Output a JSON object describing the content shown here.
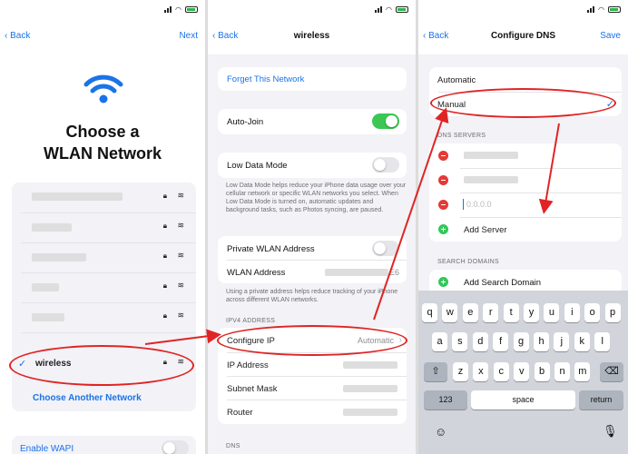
{
  "panel1": {
    "back_label": "Back",
    "next_label": "Next",
    "title_line1": "Choose a",
    "title_line2": "WLAN Network",
    "selected_network": "wireless",
    "choose_another": "Choose Another Network",
    "enable_wapi": "Enable WAPI"
  },
  "panel2": {
    "back_label": "Back",
    "title": "wireless",
    "forget": "Forget This Network",
    "auto_join": "Auto-Join",
    "auto_join_on": true,
    "low_data_mode": "Low Data Mode",
    "low_data_desc": "Low Data Mode helps reduce your iPhone data usage over your cellular network or specific WLAN networks you select. When Low Data Mode is turned on, automatic updates and background tasks, such as Photos syncing, are paused.",
    "private_wlan": "Private WLAN Address",
    "wlan_address": "WLAN Address",
    "wlan_address_suffix": "E6",
    "private_desc": "Using a private address helps reduce tracking of your iPhone across different WLAN networks.",
    "ipv4_header": "IPV4 ADDRESS",
    "configure_ip": "Configure IP",
    "configure_ip_value": "Automatic",
    "ip_address": "IP Address",
    "subnet_mask": "Subnet Mask",
    "router": "Router",
    "dns_header": "DNS"
  },
  "panel3": {
    "back_label": "Back",
    "title": "Configure DNS",
    "save_label": "Save",
    "automatic": "Automatic",
    "manual": "Manual",
    "dns_servers_header": "DNS SERVERS",
    "dns_placeholder": "0.0.0.0",
    "add_server": "Add Server",
    "search_domains_header": "SEARCH DOMAINS",
    "add_search_domain": "Add Search Domain"
  },
  "keyboard": {
    "row1": [
      "q",
      "w",
      "e",
      "r",
      "t",
      "y",
      "u",
      "i",
      "o",
      "p"
    ],
    "row2": [
      "a",
      "s",
      "d",
      "f",
      "g",
      "h",
      "j",
      "k",
      "l"
    ],
    "row3": [
      "z",
      "x",
      "c",
      "v",
      "b",
      "n",
      "m"
    ],
    "num_key": "123",
    "space_key": "space",
    "return_key": "return"
  },
  "colors": {
    "accent": "#1a73e8",
    "annotation": "#e02424",
    "toggle_on": "#3bc753"
  }
}
